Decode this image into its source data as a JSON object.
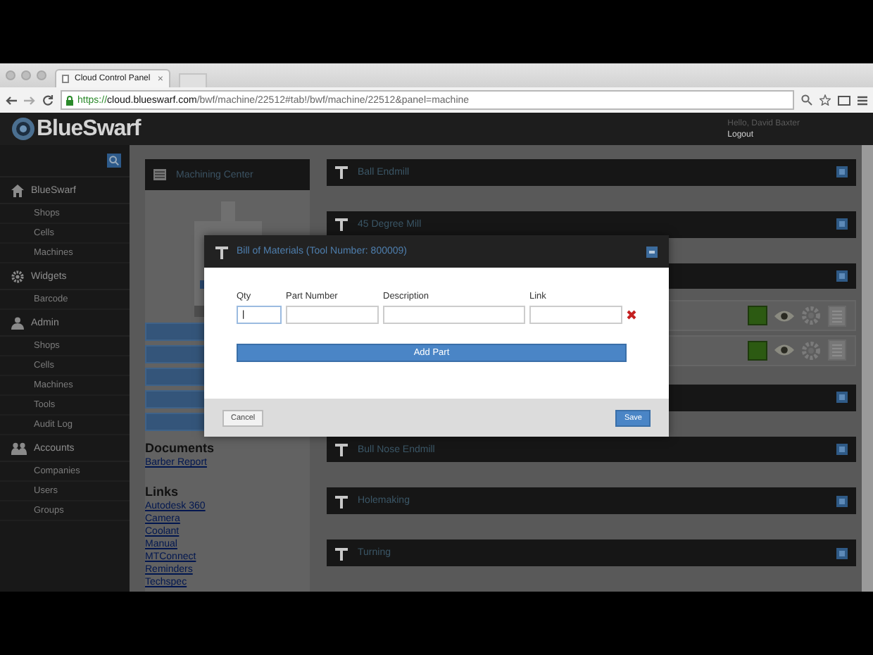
{
  "browser": {
    "tab_title": "Cloud Control Panel",
    "tab_close": "×",
    "url_scheme": "https://",
    "url_host": "cloud.blueswarf.com",
    "url_path": "/bwf/machine/22512#tab!/bwf/machine/22512&panel=machine"
  },
  "header": {
    "logo": "BlueSwarf",
    "greeting": "Hello, David Baxter",
    "logout": "Logout"
  },
  "sidebar": {
    "sections": [
      {
        "kind": "home",
        "label": "BlueSwarf",
        "items": [
          "Shops",
          "Cells",
          "Machines"
        ]
      },
      {
        "kind": "gear",
        "label": "Widgets",
        "items": [
          "Barcode"
        ]
      },
      {
        "kind": "person",
        "label": "Admin",
        "items": [
          "Shops",
          "Cells",
          "Machines",
          "Tools",
          "Audit Log"
        ]
      },
      {
        "kind": "people",
        "label": "Accounts",
        "items": [
          "Companies",
          "Users",
          "Groups"
        ]
      }
    ]
  },
  "machine": {
    "title": "Machining Center",
    "documents_heading": "Documents",
    "documents": [
      "Barber Report"
    ],
    "links_heading": "Links",
    "links": [
      "Autodesk 360",
      "Camera",
      "Coolant",
      "Manual",
      "MTConnect",
      "Reminders",
      "Techspec"
    ]
  },
  "tools": [
    {
      "kind": "panel",
      "title": "Ball Endmill"
    },
    {
      "kind": "panel",
      "title": "45 Degree Mill"
    },
    {
      "kind": "panel"
    },
    {
      "kind": "row"
    },
    {
      "kind": "row"
    },
    {
      "kind": "panel"
    },
    {
      "kind": "panel",
      "title": "Bull Nose Endmill"
    },
    {
      "kind": "panel",
      "title": "Holemaking"
    },
    {
      "kind": "panel",
      "title": "Turning"
    }
  ],
  "modal": {
    "title": "Bill of Materials (Tool Number: 800009)",
    "columns": [
      "Qty",
      "Part Number",
      "Description",
      "Link"
    ],
    "rows": [
      {
        "qty": "|"
      }
    ],
    "add_button": "Add Part",
    "cancel_button": "Cancel",
    "save_button": "Save"
  }
}
